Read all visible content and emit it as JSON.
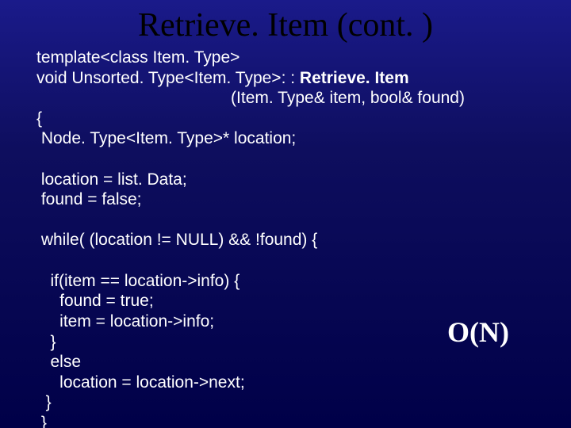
{
  "slide": {
    "title": "Retrieve. Item (cont. )",
    "code_line_1": "template<class Item. Type>",
    "code_line_2a": "void Unsorted. Type<Item. Type>: : ",
    "code_line_2b_bold": "Retrieve. Item",
    "code_line_3": "                                          (Item. Type& item, bool& found)",
    "code_line_4": "{",
    "code_line_5": " Node. Type<Item. Type>* location;",
    "code_line_6": "",
    "code_line_7": " location = list. Data;",
    "code_line_8": " found = false;",
    "code_line_9": "",
    "code_line_10": " while( (location != NULL) && !found) {",
    "code_line_11": "",
    "code_line_12": "   if(item == location->info) {",
    "code_line_13": "     found = true;",
    "code_line_14": "     item = location->info;",
    "code_line_15": "   }",
    "code_line_16": "   else",
    "code_line_17": "     location = location->next;",
    "code_line_18": "  }",
    "code_line_19": " }",
    "complexity": "O(N)"
  }
}
